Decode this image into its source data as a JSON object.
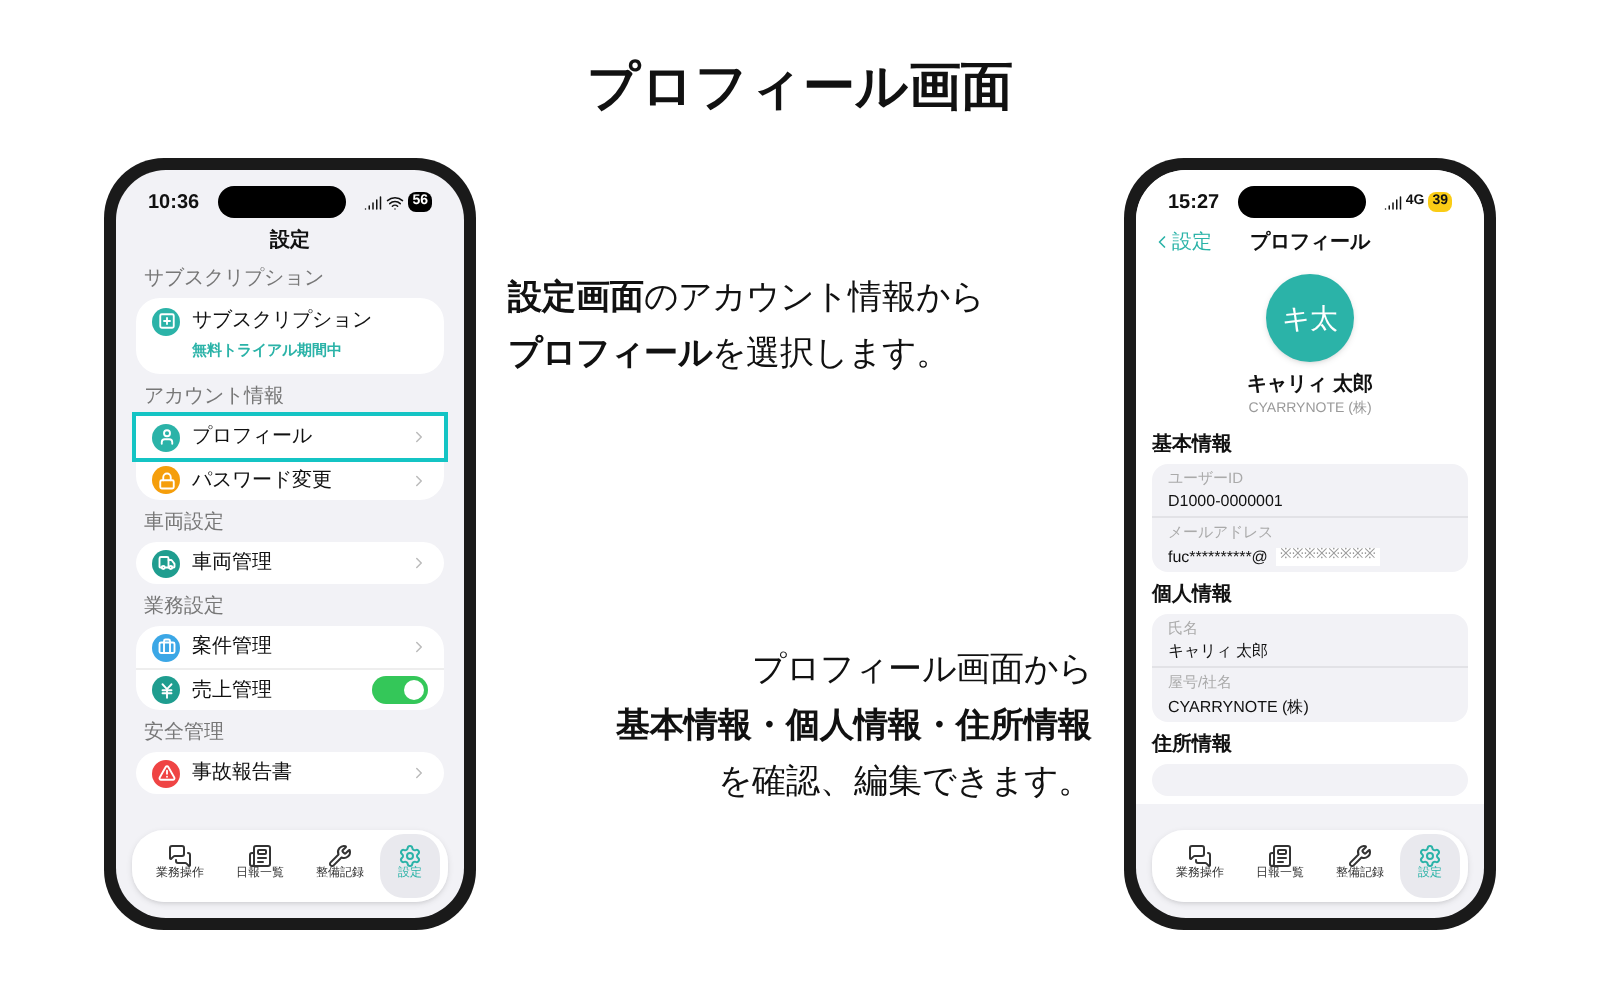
{
  "title": "プロフィール画面",
  "settings_phone": {
    "status": {
      "time": "10:36",
      "battery": "56"
    },
    "nav_title": "設定",
    "sections": [
      {
        "header": "サブスクリプション",
        "items": [
          {
            "kind": "subscription",
            "label": "サブスクリプション",
            "sublabel": "無料トライアル期間中"
          }
        ]
      },
      {
        "header": "アカウント情報",
        "items": [
          {
            "kind": "link",
            "label": "プロフィール",
            "highlighted": true
          },
          {
            "kind": "link",
            "label": "パスワード変更",
            "highlighted": false
          }
        ]
      },
      {
        "header": "車両設定",
        "items": [
          {
            "kind": "link",
            "label": "車両管理",
            "highlighted": false
          }
        ]
      },
      {
        "header": "業務設定",
        "items": [
          {
            "kind": "link",
            "label": "案件管理",
            "highlighted": false
          },
          {
            "kind": "toggle",
            "label": "売上管理",
            "on": true
          }
        ]
      },
      {
        "header": "安全管理",
        "items": [
          {
            "kind": "link",
            "label": "事故報告書",
            "highlighted": false
          }
        ]
      }
    ],
    "tab_bar": [
      {
        "label": "業務操作",
        "selected": false
      },
      {
        "label": "日報一覧",
        "selected": false
      },
      {
        "label": "整備記録",
        "selected": false
      },
      {
        "label": "設定",
        "selected": true
      }
    ]
  },
  "caption_settings": [
    "**設定画面**のアカウント情報から",
    "**プロフィール**を選択します。"
  ],
  "caption_profile": [
    "プロフィール画面から",
    "**基本情報・個人情報・住所情報**",
    "を確認、編集できます。"
  ],
  "profile_phone": {
    "status": {
      "time": "15:27",
      "network": "4G",
      "battery": "39"
    },
    "back": "設定",
    "nav_title": "プロフィール",
    "avatar": "キ太",
    "name": "キャリィ 太郎",
    "company": "CYARRYNOTE (株)",
    "sections": [
      {
        "header": "基本情報",
        "fields": [
          {
            "label": "ユーザーID",
            "value": "D1000-0000001"
          },
          {
            "label": "メールアドレス",
            "value": "fuc**********@",
            "masked": "※※※※※※※※"
          }
        ]
      },
      {
        "header": "個人情報",
        "fields": [
          {
            "label": "氏名",
            "value": "キャリィ 太郎"
          },
          {
            "label": "屋号/社名",
            "value": "CYARRYNOTE (株)"
          }
        ]
      },
      {
        "header": "住所情報"
      }
    ],
    "tab_bar": [
      {
        "label": "業務操作",
        "selected": false
      },
      {
        "label": "日報一覧",
        "selected": false
      },
      {
        "label": "整備記録",
        "selected": false
      },
      {
        "label": "設定",
        "selected": true
      }
    ]
  }
}
